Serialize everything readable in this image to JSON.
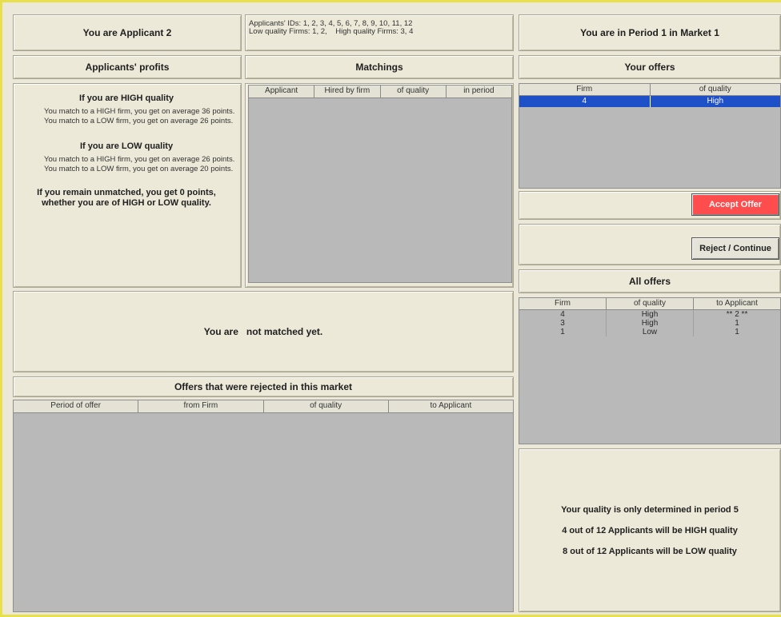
{
  "header": {
    "applicant_label": "You are Applicant",
    "applicant_id": "2",
    "ids_line1": "Applicants' IDs: 1, 2, 3, 4, 5, 6, 7, 8, 9, 10, 11, 12",
    "ids_line2": "Low quality Firms: 1, 2,    High quality Firms: 3, 4",
    "period_text": "You are in Period 1 in Market 1"
  },
  "profits": {
    "title": "Applicants' profits",
    "high_heading": "If you are HIGH quality",
    "high_line1": "You match to a HIGH firm, you get on average 36 points.",
    "high_line2": "You match to a LOW firm, you get on average 26 points.",
    "low_heading": "If you are LOW quality",
    "low_line1": "You match to a HIGH firm, you get on average 26 points.",
    "low_line2": "You match to a LOW firm, you get on average 20 points.",
    "unmatched": "If you remain unmatched, you get 0 points, whether you are of HIGH or LOW quality."
  },
  "matchings": {
    "title": "Matchings",
    "columns": [
      "Applicant",
      "Hired by firm",
      "of quality",
      "in period"
    ]
  },
  "status": {
    "prefix": "You are",
    "text": "not matched yet."
  },
  "rejected": {
    "title": "Offers that were rejected in this market",
    "columns": [
      "Period of offer",
      "from Firm",
      "of quality",
      "to Applicant"
    ]
  },
  "your_offers": {
    "title": "Your offers",
    "columns": [
      "Firm",
      "of quality"
    ],
    "rows": [
      {
        "firm": "4",
        "quality": "High"
      }
    ]
  },
  "buttons": {
    "accept": "Accept Offer",
    "reject": "Reject / Continue"
  },
  "all_offers": {
    "title": "All offers",
    "columns": [
      "Firm",
      "of quality",
      "to Applicant"
    ],
    "rows": [
      {
        "firm": "4",
        "quality": "High",
        "to": "** 2 **"
      },
      {
        "firm": "3",
        "quality": "High",
        "to": "1"
      },
      {
        "firm": "1",
        "quality": "Low",
        "to": "1"
      }
    ]
  },
  "info": {
    "line1": "Your quality is only determined in period 5",
    "line2": "4 out of 12 Applicants will be HIGH quality",
    "line3": "8 out of 12 Applicants will be LOW quality"
  },
  "colors": {
    "accept_button": "#ff4c4c",
    "selected_row": "#1e50c8",
    "frame_border": "#e8e04a"
  }
}
